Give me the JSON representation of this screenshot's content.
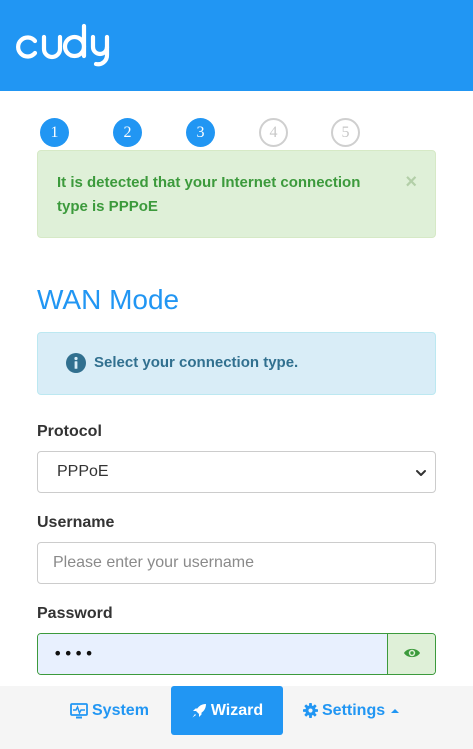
{
  "header": {
    "logo_text": "cudy",
    "brand_color": "#2196f3"
  },
  "wizard_steps": [
    {
      "number": "1",
      "state": "active"
    },
    {
      "number": "2",
      "state": "active"
    },
    {
      "number": "3",
      "state": "active"
    },
    {
      "number": "4",
      "state": "inactive"
    },
    {
      "number": "5",
      "state": "inactive"
    }
  ],
  "detection_alert": {
    "message": "It is detected that your Internet connection type is PPPoE",
    "close_symbol": "×"
  },
  "section_title": "WAN Mode",
  "info_alert": {
    "icon": "info-icon",
    "message": "Select your connection type."
  },
  "form": {
    "protocol": {
      "label": "Protocol",
      "value": "PPPoE"
    },
    "username": {
      "label": "Username",
      "placeholder": "Please enter your username",
      "value": ""
    },
    "password": {
      "label": "Password",
      "masked_value": "••••",
      "toggle_icon": "eye-icon"
    }
  },
  "footer_nav": [
    {
      "label": "System",
      "icon": "monitor-icon",
      "active": false
    },
    {
      "label": "Wizard",
      "icon": "rocket-icon",
      "active": true
    },
    {
      "label": "Settings",
      "icon": "gear-icon",
      "active": false
    }
  ]
}
